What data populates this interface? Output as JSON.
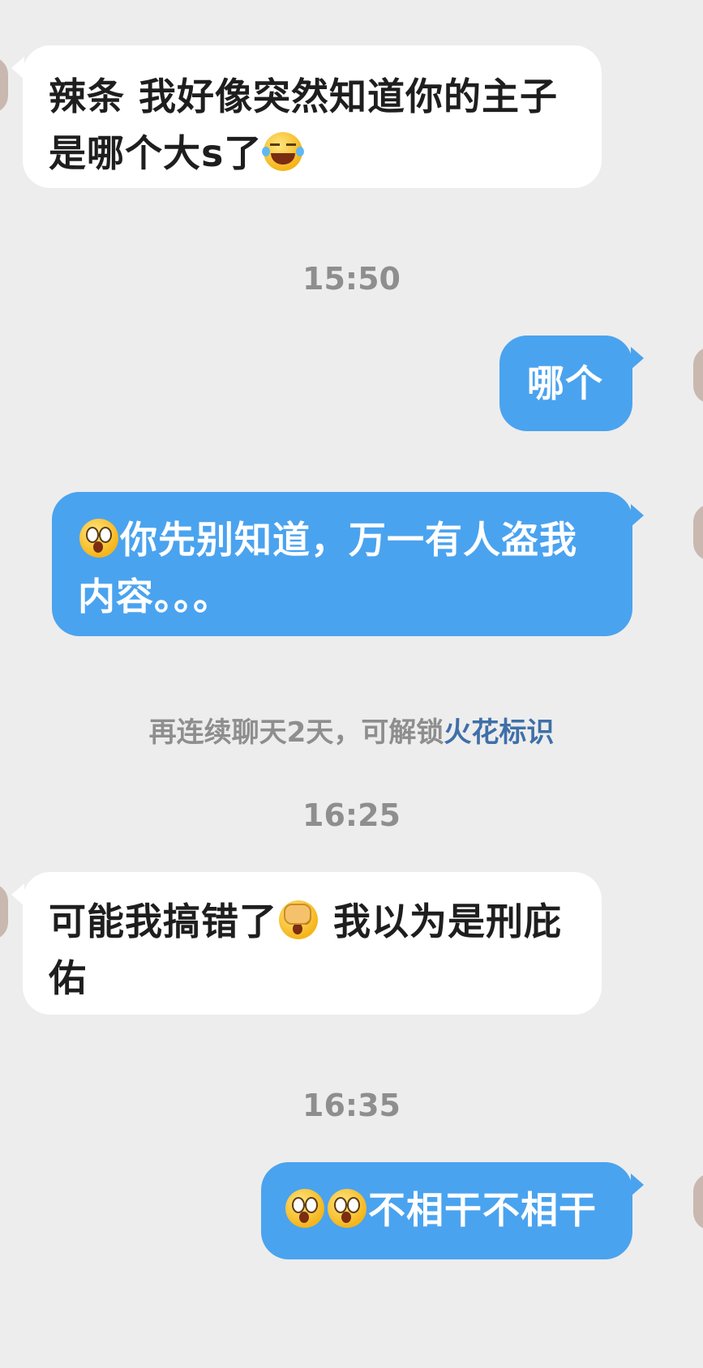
{
  "messages": [
    {
      "direction": "in",
      "text_before": "辣条 我好像突然知道你的主子是哪个大s了",
      "emoji": "joy-tears",
      "text_after": ""
    },
    {
      "direction": "out",
      "text": "哪个"
    },
    {
      "direction": "out",
      "emoji": "astonished",
      "text": "你先别知道，万一有人盗我内容。。。"
    },
    {
      "direction": "in",
      "text_before": "可能我搞错了",
      "emoji": "facepalm",
      "text_after": " 我以为是刑庇佑"
    },
    {
      "direction": "out",
      "emojis": [
        "astonished",
        "astonished"
      ],
      "text": "不相干不相干"
    }
  ],
  "timestamps": [
    "15:50",
    "16:25",
    "16:35"
  ],
  "notice": {
    "text": "再连续聊天2天，可解锁",
    "link": "火花标识"
  },
  "colors": {
    "background": "#ededed",
    "incoming_bubble": "#ffffff",
    "outgoing_bubble": "#4aa3ef",
    "link": "#3f6fa8"
  }
}
